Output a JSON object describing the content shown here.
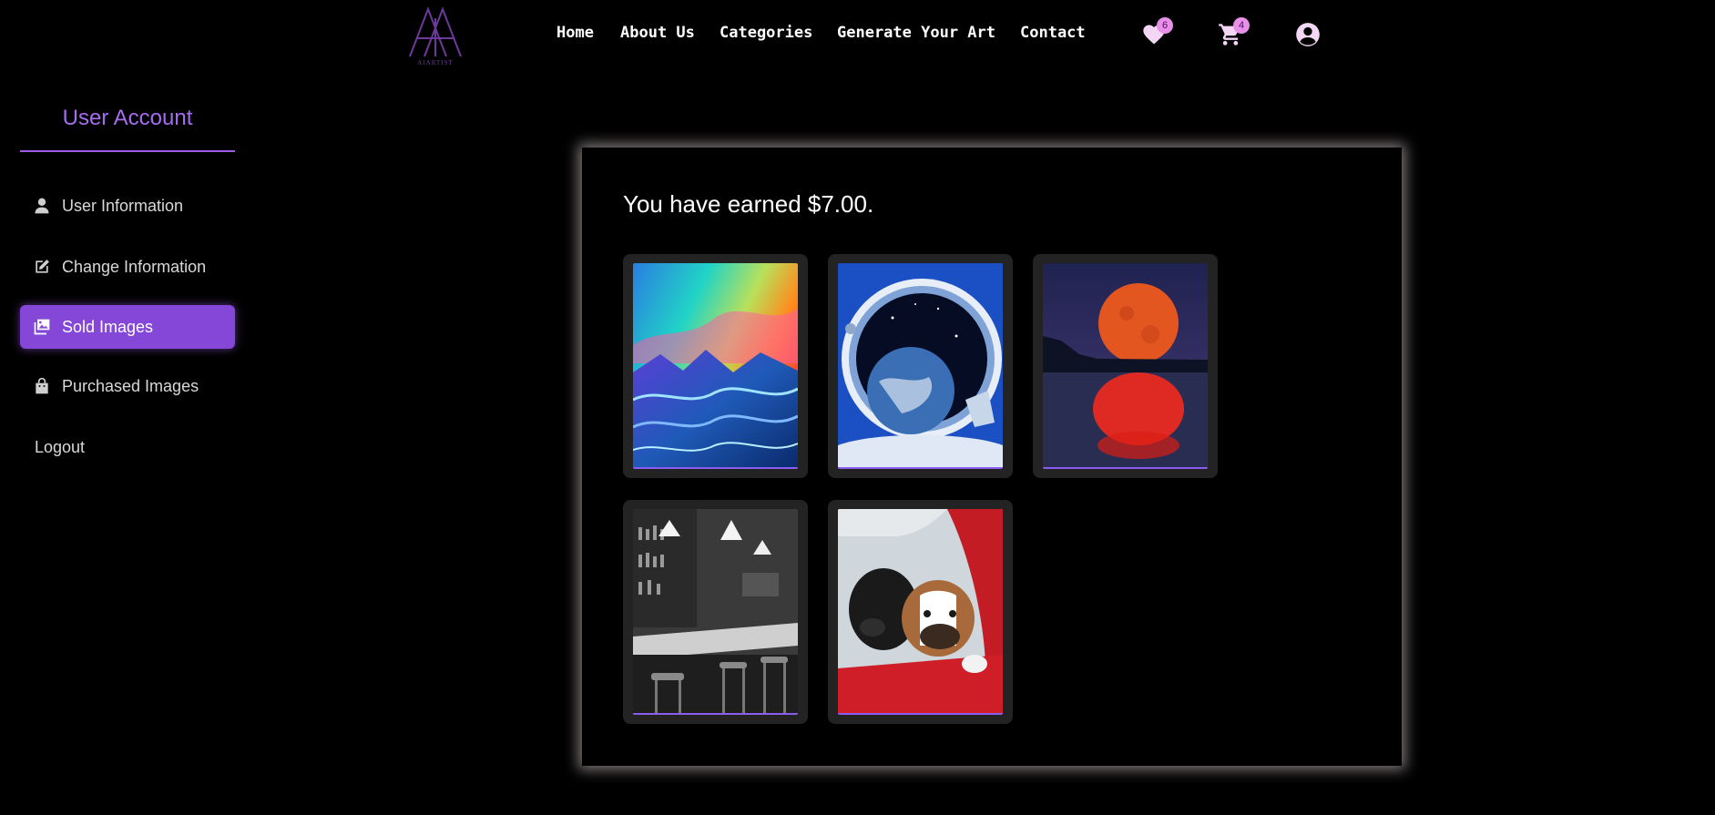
{
  "brand": {
    "logo_text": "AIARTIST",
    "accent": "#8547d8",
    "logo_color": "#6c3a9c"
  },
  "nav": {
    "links": [
      "Home",
      "About Us",
      "Categories",
      "Generate Your Art",
      "Contact"
    ],
    "wishlist": {
      "icon": "heart-icon",
      "count": "6"
    },
    "cart": {
      "icon": "cart-icon",
      "count": "4"
    },
    "account": {
      "icon": "user-circle-icon"
    }
  },
  "sidebar": {
    "title": "User Account",
    "items": [
      {
        "label": "User Information",
        "icon": "user-icon"
      },
      {
        "label": "Change Information",
        "icon": "edit-icon"
      },
      {
        "label": "Sold Images",
        "icon": "images-icon",
        "active": true
      },
      {
        "label": "Purchased Images",
        "icon": "bag-icon"
      },
      {
        "label": "Logout"
      }
    ]
  },
  "main": {
    "earnings_text": "You have earned $7.00.",
    "sold_images": [
      {
        "subject": "colorful stormy ocean waves painting"
      },
      {
        "subject": "astronaut helmet reflecting earth"
      },
      {
        "subject": "red full moon over water"
      },
      {
        "subject": "black and white bar interior"
      },
      {
        "subject": "two dogs looking out of red car window"
      }
    ]
  }
}
